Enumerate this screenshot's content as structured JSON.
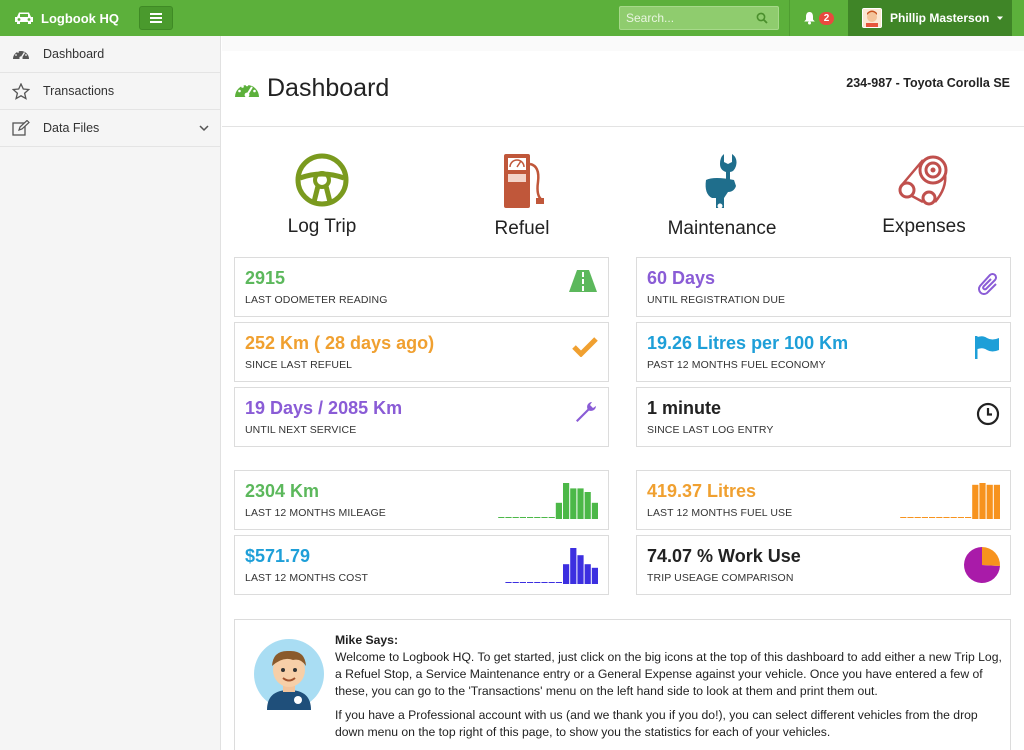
{
  "app": {
    "title": "Logbook HQ"
  },
  "search": {
    "placeholder": "Search..."
  },
  "notifications": {
    "count": "2"
  },
  "user": {
    "name": "Phillip Masterson"
  },
  "sidebar": {
    "items": [
      {
        "label": "Dashboard",
        "icon": "dashboard-icon"
      },
      {
        "label": "Transactions",
        "icon": "star-icon"
      },
      {
        "label": "Data Files",
        "icon": "edit-icon"
      }
    ]
  },
  "page": {
    "title": "Dashboard",
    "vehicle": "234-987 - Toyota Corolla SE"
  },
  "actions": [
    {
      "label": "Log Trip",
      "icon": "steering-wheel-icon",
      "color": "#7a9a1e"
    },
    {
      "label": "Refuel",
      "icon": "fuel-pump-icon",
      "color": "#c0573a"
    },
    {
      "label": "Maintenance",
      "icon": "wrench-hand-icon",
      "color": "#1f6e8c"
    },
    {
      "label": "Expenses",
      "icon": "engine-belt-icon",
      "color": "#c0504d"
    }
  ],
  "stats": {
    "odometer": {
      "value": "2915",
      "label": "LAST ODOMETER READING",
      "color": "#5cb85c"
    },
    "refuel": {
      "value": "252 Km ( 28 days ago)",
      "label": "SINCE LAST REFUEL",
      "color": "#f0a030"
    },
    "service": {
      "value": "19 Days / 2085 Km",
      "label": "UNTIL NEXT SERVICE",
      "color": "#8a5cd6"
    },
    "registration": {
      "value": "60 Days",
      "label": "UNTIL REGISTRATION DUE",
      "color": "#8a5cd6"
    },
    "economy": {
      "value": "19.26 Litres per 100 Km",
      "label": "PAST 12 MONTHS FUEL ECONOMY",
      "color": "#1e9fd8"
    },
    "log_entry": {
      "value": "1 minute",
      "label": "SINCE LAST LOG ENTRY",
      "color": "#222222"
    },
    "mileage": {
      "value": "2304 Km",
      "label": "LAST 12 MONTHS MILEAGE",
      "color": "#5cb85c",
      "bars": [
        0,
        0,
        0,
        0,
        0,
        0,
        0,
        0,
        0.45,
        1,
        0.85,
        0.85,
        0.75,
        0.45
      ]
    },
    "cost": {
      "value": "$571.79",
      "label": "LAST 12 MONTHS COST",
      "color": "#1e9fd8",
      "bars": [
        0,
        0,
        0,
        0,
        0,
        0,
        0,
        0,
        0.55,
        1,
        0.8,
        0.55,
        0.45
      ]
    },
    "fuel_use": {
      "value": "419.37 Litres",
      "label": "LAST 12 MONTHS FUEL USE",
      "color": "#f0a030",
      "bars": [
        0,
        0,
        0,
        0,
        0,
        0,
        0,
        0,
        0,
        0,
        0.95,
        1,
        0.95,
        0.95
      ]
    },
    "work_use": {
      "value": "74.07 % Work Use",
      "label": "TRIP USEAGE COMPARISON",
      "color": "#222222",
      "pie": [
        74.07,
        25.93
      ]
    }
  },
  "colors": {
    "mileage_bars": "#4cb848",
    "cost_bars": "#3c2fe0",
    "fuel_bars": "#f7931e",
    "pie_work": "#a91ba9",
    "pie_private": "#f7931e"
  },
  "mike": {
    "heading": "Mike Says:",
    "p1": "Welcome to Logbook HQ. To get started, just click on the big icons at the top of this dashboard to add either a new Trip Log, a Refuel Stop, a Service Maintenance entry or a General Expense against your vehicle. Once you have entered a few of these, you can go to the 'Transactions' menu on the left hand side to look at them and print them out.",
    "p2": "If you have a Professional account with us (and we thank you if you do!), you can select different vehicles from the drop down menu on the top right of this page, to show you the statistics for each of your vehicles."
  }
}
